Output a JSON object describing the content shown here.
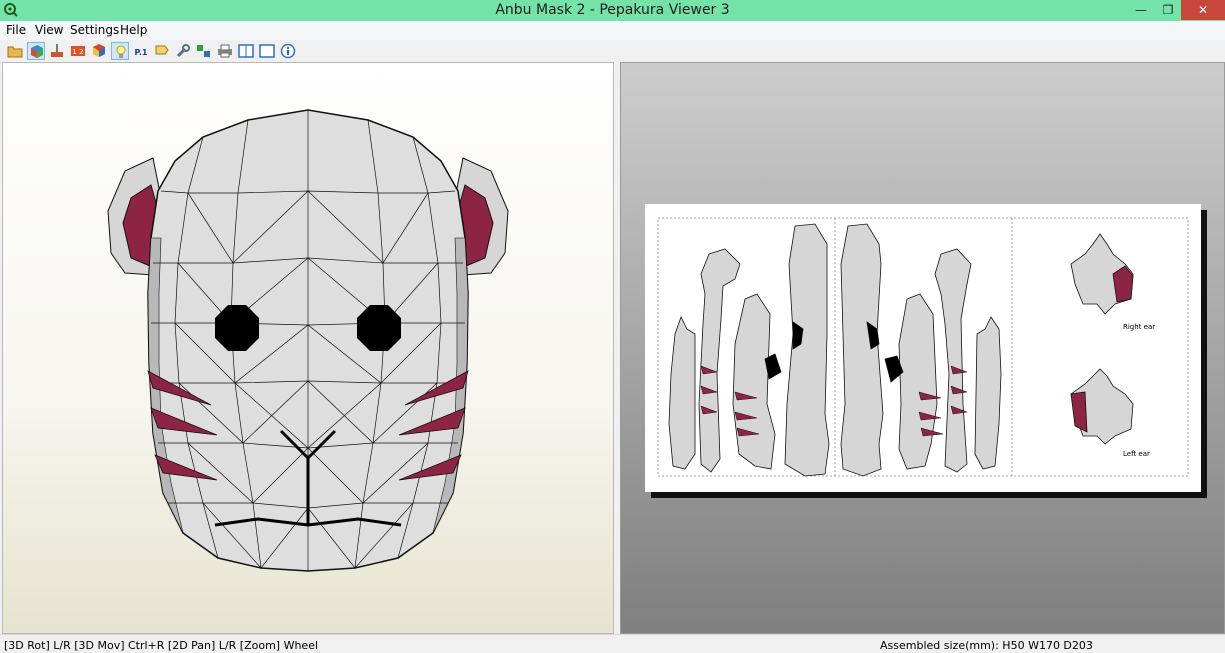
{
  "window": {
    "title": "Anbu Mask 2 - Pepakura Viewer 3",
    "minimize_glyph": "—",
    "maximize_glyph": "❐",
    "close_glyph": "✕"
  },
  "menu": {
    "items": [
      "File",
      "View",
      "Settings",
      "Help"
    ]
  },
  "toolbar": {
    "icons": [
      "open-folder-icon",
      "3d-view-icon",
      "print-settings-icon",
      "page-number-icon",
      "texture-icon",
      "lightbulb-icon",
      "page-label-icon",
      "flap-icon",
      "wrench-icon",
      "unfold-icon",
      "printer-icon",
      "window-split-icon",
      "window-single-icon",
      "info-icon"
    ],
    "page_label": "P.1",
    "active": [
      "3d-view-icon",
      "lightbulb-icon"
    ]
  },
  "pattern_sheet": {
    "labels": {
      "right_ear": "Right ear",
      "left_ear": "Left ear"
    }
  },
  "status": {
    "controls": "[3D Rot] L/R [3D Mov] Ctrl+R [2D Pan] L/R [Zoom] Wheel",
    "assembled_size": "Assembled size(mm): H50 W170 D203"
  },
  "colors": {
    "titlebar": "#74e3a7",
    "close_button": "#c7473a",
    "mask_paper": "#dcdcdc",
    "mask_accent": "#8e2445",
    "eyes": "#000000"
  }
}
